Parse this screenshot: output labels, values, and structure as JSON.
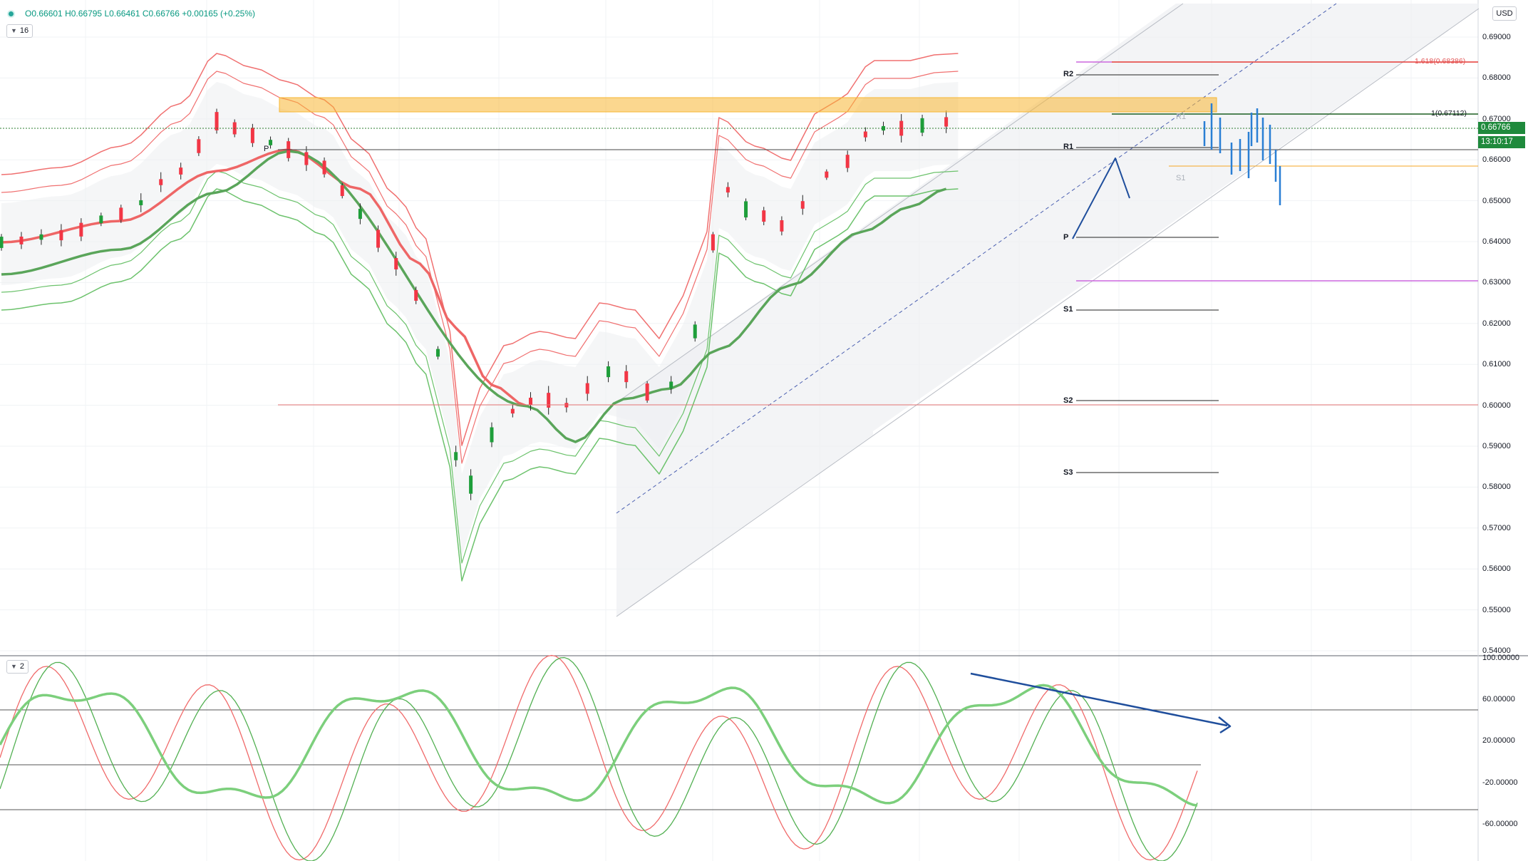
{
  "header": {
    "open": "O0.66601",
    "high": "H0.66795",
    "low": "L0.66461",
    "close": "C0.66766",
    "change": "+0.00165 (+0.25%)"
  },
  "main_pane_badge": "16",
  "osc_pane_badge": "2",
  "currency_button": "USD",
  "last_price_tag": "0.66766",
  "countdown_tag": "13:10:17",
  "price_axis": [
    "0.69000",
    "0.68000",
    "0.67000",
    "0.66000",
    "0.65000",
    "0.64000",
    "0.63000",
    "0.62000",
    "0.61000",
    "0.60000",
    "0.59000",
    "0.58000",
    "0.57000",
    "0.56000",
    "0.55000",
    "0.54000"
  ],
  "osc_axis": [
    "100.00000",
    "60.00000",
    "20.00000",
    "-20.00000",
    "-60.00000"
  ],
  "pivot_labels": {
    "r2": "R2",
    "r1": "R1",
    "p": "P",
    "s1": "S1",
    "s2": "S2",
    "s3": "S3",
    "p_left": "P",
    "r1_small": "R1",
    "s1_small": "S1"
  },
  "fib_labels": {
    "f1618": "1.618(0.68386)",
    "f1": "1(0.67112)"
  },
  "colors": {
    "up": "#1e9e3a",
    "down": "#f23645",
    "bb_red": "#f07070",
    "bb_green": "#6cc26c",
    "ma_green": "#5aa55a",
    "ma_red": "#ee6666",
    "channel": "#b8bcc4",
    "zone": "#f7b733",
    "projection": "#2a7fd4",
    "arrow": "#1f4e9c",
    "price_tag": "#1f8a3c"
  }
}
